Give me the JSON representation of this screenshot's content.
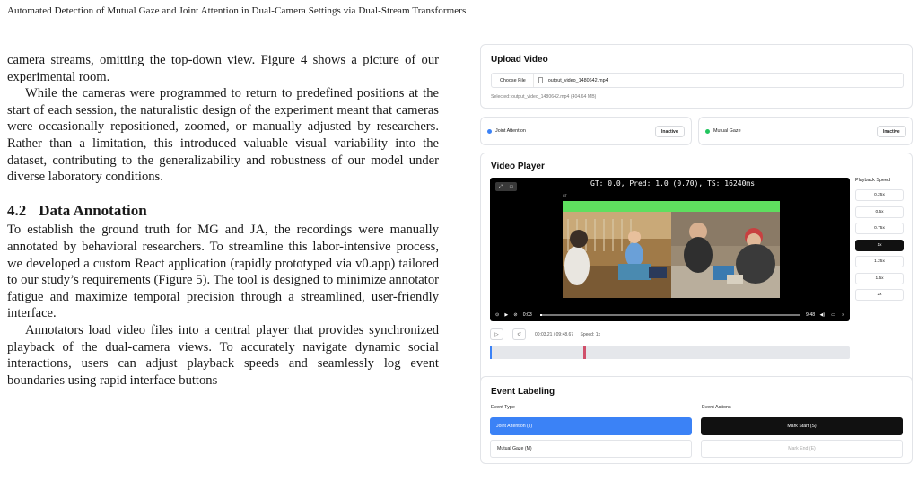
{
  "running_header": "Automated Detection of Mutual Gaze and Joint Attention in Dual-Camera Settings via Dual-Stream Transformers",
  "paragraphs": {
    "p1": "camera streams, omitting the top-down view. Figure 4 shows a picture of our experimental room.",
    "p2": "While the cameras were programmed to return to predefined positions at the start of each session, the naturalistic design of the experiment meant that cameras were occasionally repositioned, zoomed, or manually adjusted by researchers. Rather than a limitation, this introduced valuable visual variability into the dataset, contributing to the generalizability and robustness of our model under diverse laboratory conditions.",
    "p3": "To establish the ground truth for MG and JA, the recordings were manually annotated by behavioral researchers. To streamline this labor-intensive process, we developed a custom React application (rapidly prototyped via v0.app) tailored to our study’s requirements (Figure 5). The tool is designed to minimize annotator fatigue and maximize temporal precision through a streamlined, user-friendly interface.",
    "p4": "Annotators load video files into a central player that provides synchronized playback of the dual-camera views. To accurately navigate dynamic social interactions, users can adjust playback speeds and seamlessly log event boundaries using rapid interface buttons"
  },
  "section": {
    "number": "4.2",
    "title": "Data Annotation"
  },
  "ui": {
    "upload": {
      "title": "Upload Video",
      "choose_file": "Choose File",
      "file_name": "output_video_1480642.mp4",
      "selected": "Selected: output_video_1480642.mp4 (404.64 MB)"
    },
    "status": {
      "joint_attention": {
        "label": "Joint Attention",
        "state": "Inactive",
        "dot_color": "#3b82f6"
      },
      "mutual_gaze": {
        "label": "Mutual Gaze",
        "state": "Inactive",
        "dot_color": "#22c55e"
      }
    },
    "player": {
      "title": "Video Player",
      "overlay": "GT: 0.0, Pred: 1.0 (0.70), TS: 16240ms",
      "gt_label": "GT",
      "current_time": "0:03",
      "total_time": "9:48",
      "progress": 0.006,
      "time_info": "00:03.21 / 09:48.67",
      "speed_info": "Speed: 1x",
      "speed_title": "Playback Speed",
      "speeds": [
        "0.25x",
        "0.5x",
        "0.75x",
        "1x",
        "1.25x",
        "1.5x",
        "2x"
      ],
      "active_speed": "1x",
      "gt_bar_color": "#5fdf5f"
    },
    "labeling": {
      "title": "Event Labeling",
      "type_label": "Event Type",
      "actions_label": "Event Actions",
      "types": [
        "Joint Attention (J)",
        "Mutual Gaze (M)"
      ],
      "actions": [
        "Mark Start (S)",
        "Mark End (E)"
      ],
      "accent": "#3b82f6"
    }
  }
}
